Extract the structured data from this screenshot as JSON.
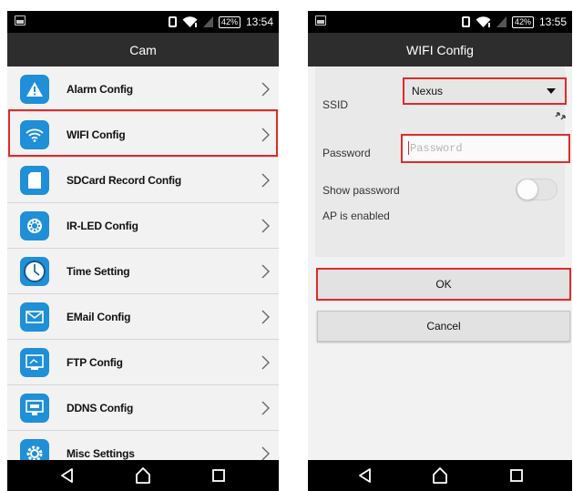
{
  "left_screen": {
    "status": {
      "battery": "42%",
      "time": "13:54"
    },
    "title": "Cam",
    "items": [
      {
        "label": "Alarm Config",
        "icon": "warning-icon"
      },
      {
        "label": "WIFI Config",
        "icon": "wifi-icon",
        "highlighted": true
      },
      {
        "label": "SDCard Record Config",
        "icon": "sdcard-icon"
      },
      {
        "label": "IR-LED Config",
        "icon": "ir-led-icon"
      },
      {
        "label": "Time Setting",
        "icon": "clock-icon"
      },
      {
        "label": "EMail Config",
        "icon": "email-icon"
      },
      {
        "label": "FTP Config",
        "icon": "ftp-icon"
      },
      {
        "label": "DDNS Config",
        "icon": "ddns-icon"
      },
      {
        "label": "Misc Settings",
        "icon": "gear-icon"
      }
    ]
  },
  "right_screen": {
    "status": {
      "battery": "42%",
      "time": "13:55"
    },
    "title": "WIFI Config",
    "ssid": {
      "label": "SSID",
      "selected": "Nexus"
    },
    "password": {
      "label": "Password",
      "placeholder": "Password",
      "value": ""
    },
    "show_password": {
      "label": "Show password",
      "enabled": false
    },
    "ap_status": "AP is enabled",
    "ok_label": "OK",
    "cancel_label": "Cancel"
  },
  "colors": {
    "accent_icon": "#1f8fd8",
    "highlight": "#e02b2b",
    "title_bar": "#2d2d2d"
  }
}
